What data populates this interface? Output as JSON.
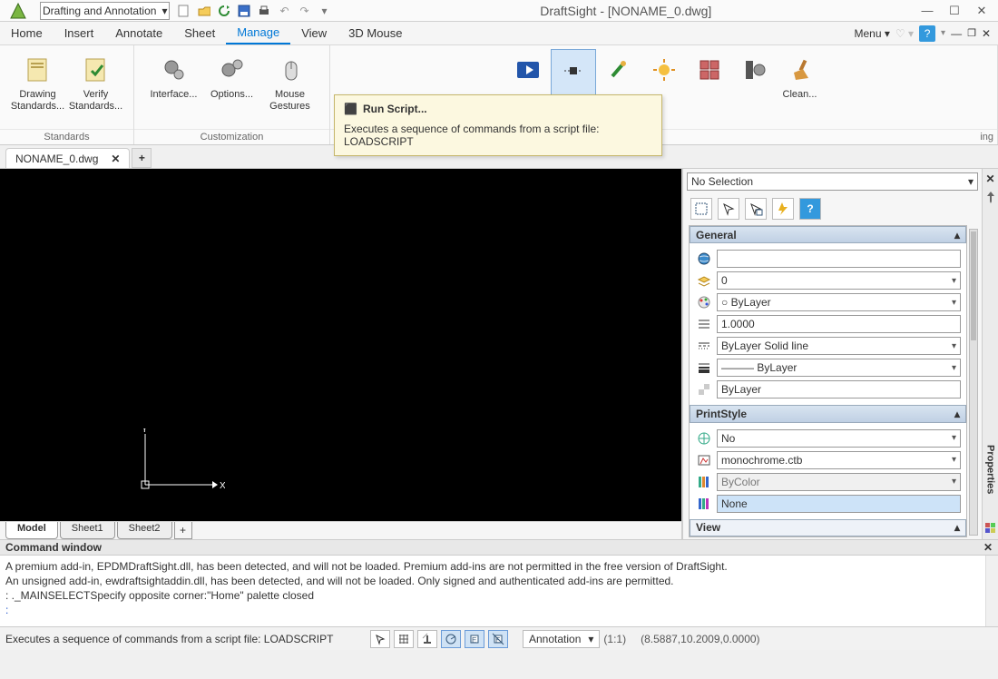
{
  "app": {
    "title": "DraftSight - [NONAME_0.dwg]"
  },
  "workspace": {
    "value": "Drafting and Annotation"
  },
  "menubar": {
    "tabs": [
      "Home",
      "Insert",
      "Annotate",
      "Sheet",
      "Manage",
      "View",
      "3D Mouse"
    ],
    "active": 4,
    "menu_label": "Menu",
    "help": "?"
  },
  "ribbon": {
    "groups": [
      {
        "label": "Standards",
        "btns": [
          {
            "label": "Drawing\nStandards...",
            "icon": "sheet"
          },
          {
            "label": "Verify\nStandards...",
            "icon": "sheet-check"
          }
        ]
      },
      {
        "label": "Customization",
        "btns": [
          {
            "label": "Interface...",
            "icon": "gears"
          },
          {
            "label": "Options...",
            "icon": "gears2"
          },
          {
            "label": "Mouse\nGestures",
            "icon": "mouse"
          }
        ]
      },
      {
        "label": "",
        "btns": [
          {
            "label": "",
            "icon": "play"
          },
          {
            "label": "",
            "icon": "record",
            "active": true
          },
          {
            "label": "",
            "icon": "attach"
          },
          {
            "label": "",
            "icon": "sun"
          },
          {
            "label": "",
            "icon": "grid4"
          },
          {
            "label": "",
            "icon": "filmgear"
          },
          {
            "label": "Clean...",
            "icon": "broom"
          }
        ],
        "trail": "ing"
      }
    ]
  },
  "tooltip": {
    "title": "Run Script...",
    "body": "Executes a sequence of commands from a script file:  LOADSCRIPT"
  },
  "file_tabs": {
    "name": "NONAME_0.dwg"
  },
  "sheets": {
    "items": [
      "Model",
      "Sheet1",
      "Sheet2"
    ],
    "active": 0
  },
  "props": {
    "selector": "No Selection",
    "general": {
      "title": "General",
      "layer": "0",
      "color": "ByLayer",
      "scale": "1.0000",
      "line": "ByLayer    Solid line",
      "lw": "ByLayer",
      "trans": "ByLayer"
    },
    "printstyle": {
      "title": "PrintStyle",
      "active": "No",
      "table": "monochrome.ctb",
      "mode": "ByColor",
      "space": "None"
    },
    "view": {
      "title": "View"
    }
  },
  "right_label": "Properties",
  "cmd": {
    "title": "Command window",
    "line1": "A premium add-in, EPDMDraftSight.dll, has been detected, and will not be loaded. Premium add-ins are not permitted in the free version of DraftSight.",
    "line2": "An unsigned add-in, ewdraftsightaddin.dll, has been detected, and will not be loaded. Only signed and authenticated add-ins are permitted.",
    "line3": ": ._MAINSELECTSpecify opposite corner:\"Home\" palette closed",
    "prompt": ": "
  },
  "status": {
    "hint": "Executes a sequence of commands from a script file:  LOADSCRIPT",
    "anno": "Annotation",
    "scale": "(1:1)",
    "coords": "(8.5887,10.2009,0.0000)"
  }
}
